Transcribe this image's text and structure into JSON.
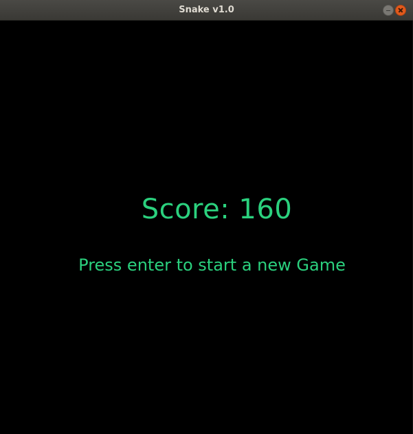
{
  "window": {
    "title": "Snake v1.0"
  },
  "game": {
    "score_text": "Score: 160",
    "prompt_text": "Press enter to start a new Game"
  },
  "colors": {
    "text_accent": "#2bd17e",
    "background": "#000000",
    "close_button": "#e25a1c"
  }
}
